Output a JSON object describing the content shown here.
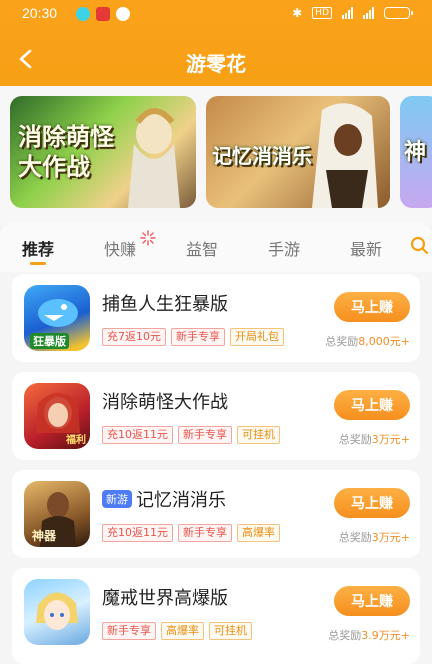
{
  "status_bar": {
    "time": "20:30",
    "network_badge": "HD"
  },
  "header": {
    "title": "游零花"
  },
  "banners": [
    {
      "text": "消除萌怪大作战"
    },
    {
      "text": "记忆消消乐"
    },
    {
      "text": "神"
    }
  ],
  "tabs": [
    {
      "label": "推荐",
      "active": true
    },
    {
      "label": "快赚"
    },
    {
      "label": "益智"
    },
    {
      "label": "手游"
    },
    {
      "label": "最新"
    }
  ],
  "games": [
    {
      "name": "捕鱼人生狂暴版",
      "new": false,
      "tags": [
        "充7返10元",
        "新手专享",
        "开局礼包"
      ],
      "button": "马上赚",
      "reward_prefix": "总奖励",
      "reward": "8,000元+",
      "icon_text": "狂暴版"
    },
    {
      "name": "消除萌怪大作战",
      "new": false,
      "tags": [
        "充10返11元",
        "新手专享",
        "可挂机"
      ],
      "button": "马上赚",
      "reward_prefix": "总奖励",
      "reward": "3万元+",
      "icon_text": "福利"
    },
    {
      "name": "记忆消消乐",
      "new": true,
      "new_label": "新游",
      "tags": [
        "充10返11元",
        "新手专享",
        "高爆率"
      ],
      "button": "马上赚",
      "reward_prefix": "总奖励",
      "reward": "3万元+",
      "icon_text": "神器"
    },
    {
      "name": "魔戒世界高爆版",
      "new": false,
      "tags": [
        "新手专享",
        "高爆率",
        "可挂机"
      ],
      "button": "马上赚",
      "reward_prefix": "总奖励",
      "reward": "3.9万元+",
      "icon_text": ""
    }
  ],
  "colors": {
    "brand": "#f6a015",
    "button": "#f58f1e",
    "tag_red": "#e8554d",
    "tag_orange": "#e88f14",
    "new_badge": "#4f7cf5"
  }
}
